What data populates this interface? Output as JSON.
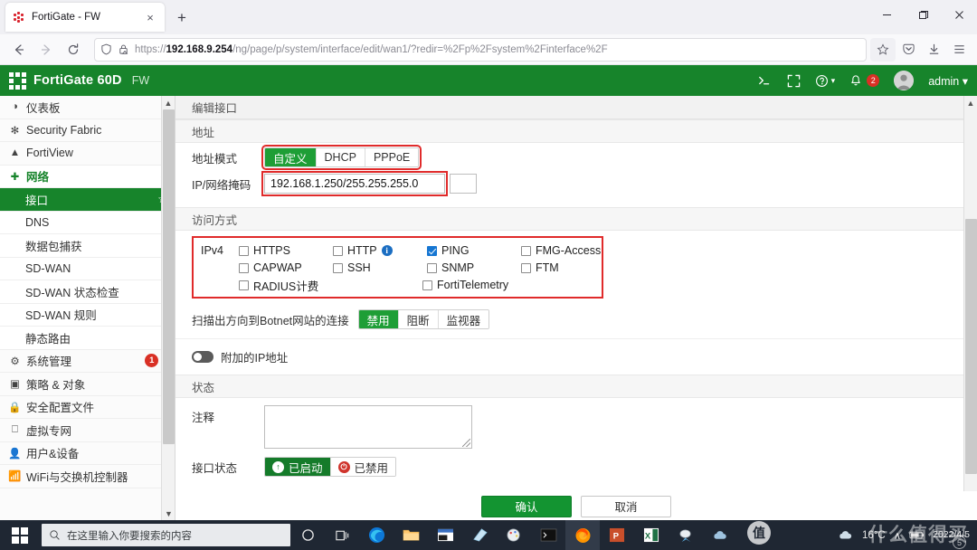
{
  "browser": {
    "tab": {
      "title": "FortiGate - FW",
      "favicon": "fortinet-favicon",
      "close_label": "×"
    },
    "newtab_label": "+",
    "window_controls": {
      "minimize": "minimize-icon",
      "maximize": "maximize-icon",
      "close": "close-icon"
    },
    "nav": {
      "back": "back-icon",
      "forward": "forward-icon",
      "reload": "reload-icon"
    },
    "url": {
      "scheme": "https://",
      "host": "192.168.9.254",
      "path": "/ng/page/p/system/interface/edit/wan1/?redir=%2Fp%2Fsystem%2Finterface%2F",
      "shield_icon": "shield-icon",
      "lock_icon": "lock-warning-icon",
      "bookmark_icon": "star-icon"
    },
    "toolbar_right": [
      "save-to-pocket-icon",
      "downloads-icon",
      "app-menu-icon"
    ]
  },
  "fortigate_header": {
    "model": "FortiGate 60D",
    "hostname": "FW",
    "cli_icon": "cli-console-icon",
    "fullscreen_icon": "fullscreen-icon",
    "help_icon": "help-icon",
    "alerts_icon": "bell-icon",
    "alerts_count": "2",
    "avatar": "user-avatar",
    "username": "admin"
  },
  "sidebar": {
    "items": [
      {
        "label": "仪表板",
        "icon": "dashboard-icon",
        "chevron": "›",
        "type": "group"
      },
      {
        "label": "Security Fabric",
        "icon": "security-fabric-icon",
        "chevron": "›",
        "type": "group"
      },
      {
        "label": "FortiView",
        "icon": "fortiview-icon",
        "chevron": "›",
        "type": "group"
      },
      {
        "label": "网络",
        "icon": "network-icon",
        "chevron": "⌄",
        "type": "group-open"
      },
      {
        "label": "接口",
        "icon": "",
        "type": "sub-active",
        "star": "☆"
      },
      {
        "label": "DNS",
        "icon": "",
        "type": "sub"
      },
      {
        "label": "数据包捕获",
        "icon": "",
        "type": "sub"
      },
      {
        "label": "SD-WAN",
        "icon": "",
        "type": "sub"
      },
      {
        "label": "SD-WAN 状态检查",
        "icon": "",
        "type": "sub"
      },
      {
        "label": "SD-WAN 规则",
        "icon": "",
        "type": "sub"
      },
      {
        "label": "静态路由",
        "icon": "",
        "type": "sub"
      },
      {
        "label": "系统管理",
        "icon": "gear-icon",
        "chevron": "›",
        "type": "group",
        "badge": "1"
      },
      {
        "label": "策略 & 对象",
        "icon": "policy-icon",
        "chevron": "›",
        "type": "group"
      },
      {
        "label": "安全配置文件",
        "icon": "lock-icon",
        "chevron": "›",
        "type": "group"
      },
      {
        "label": "虚拟专网",
        "icon": "vpn-icon",
        "chevron": "›",
        "type": "group"
      },
      {
        "label": "用户&设备",
        "icon": "user-icon",
        "chevron": "›",
        "type": "group"
      },
      {
        "label": "WiFi与交换机控制器",
        "icon": "wifi-icon",
        "chevron": "›",
        "type": "group"
      }
    ]
  },
  "content": {
    "page_title": "编辑接口",
    "address_section": "地址",
    "addressing_mode": {
      "label": "地址模式",
      "options": [
        "自定义",
        "DHCP",
        "PPPoE"
      ],
      "selected": "自定义"
    },
    "ip_netmask": {
      "label": "IP/网络掩码",
      "value": "192.168.1.250/255.255.255.0"
    },
    "access_section": "访问方式",
    "access": {
      "family_label": "IPv4",
      "columns": [
        [
          {
            "label": "HTTPS",
            "checked": false
          },
          {
            "label": "CAPWAP",
            "checked": false
          },
          {
            "label": "RADIUS计费",
            "checked": false
          }
        ],
        [
          {
            "label": "HTTP",
            "checked": false,
            "info": true
          },
          {
            "label": "SSH",
            "checked": false
          }
        ],
        [
          {
            "label": "PING",
            "checked": true
          },
          {
            "label": "SNMP",
            "checked": false
          },
          {
            "label": "FortiTelemetry",
            "checked": false
          }
        ],
        [
          {
            "label": "FMG-Access",
            "checked": false
          },
          {
            "label": "FTM",
            "checked": false
          }
        ]
      ]
    },
    "botnet": {
      "label": "扫描出方向到Botnet网站的连接",
      "options": [
        "禁用",
        "阻断",
        "监视器"
      ],
      "selected": "禁用"
    },
    "secondary_ip": {
      "label": "附加的IP地址",
      "enabled": false
    },
    "status_section": "状态",
    "comments": {
      "label": "注释",
      "value": ""
    },
    "interface_state": {
      "label": "接口状态",
      "options": [
        {
          "label": "已启动",
          "icon": "arrow-up-circle-icon",
          "selected": true
        },
        {
          "label": "已禁用",
          "icon": "power-off-circle-icon",
          "selected": false
        }
      ]
    },
    "footer": {
      "ok": "确认",
      "cancel": "取消"
    }
  },
  "taskbar": {
    "start_icon": "windows-start-icon",
    "search_placeholder": "在这里输入你要搜索的内容",
    "search_icon": "search-icon",
    "icons": [
      "cortana-icon",
      "task-view-icon",
      "edge-icon",
      "file-explorer-icon",
      "snipping-tool-icon",
      "onenote-icon",
      "paint-icon",
      "terminal-icon",
      "firefox-icon",
      "powerpoint-icon",
      "excel-icon",
      "wps-icon",
      "cloud-icon"
    ],
    "tray": {
      "weather_icon": "cloud-icon",
      "temperature": "16°C",
      "chevron": "∧",
      "battery_icon": "battery-icon",
      "date": "2022/4/5"
    },
    "watermark": {
      "text": "什么值得买",
      "badge": "值",
      "num": "5"
    }
  }
}
